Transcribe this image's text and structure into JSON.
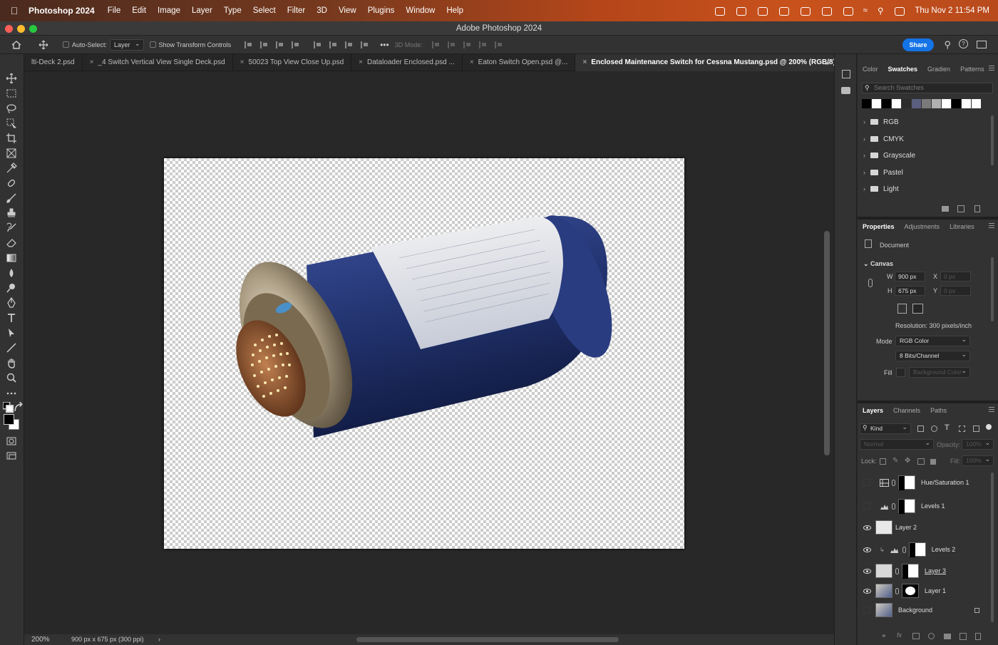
{
  "menubar": {
    "app_name": "Photoshop 2024",
    "menus": [
      "File",
      "Edit",
      "Image",
      "Layer",
      "Type",
      "Select",
      "Filter",
      "3D",
      "View",
      "Plugins",
      "Window",
      "Help"
    ],
    "clock": "Thu Nov 2  11:54 PM"
  },
  "window": {
    "title": "Adobe Photoshop 2024"
  },
  "options": {
    "auto_select_label": "Auto-Select:",
    "auto_select_value": "Layer",
    "transform_controls_label": "Show Transform Controls",
    "mode_3d_label": "3D Mode:",
    "share_label": "Share"
  },
  "tabs": [
    {
      "label": "lti-Deck 2.psd",
      "active": false
    },
    {
      "label": "_4 Switch Vertical View Single Deck.psd",
      "active": false
    },
    {
      "label": "50023 Top View Close Up.psd",
      "active": false
    },
    {
      "label": "Dataloader Enclosed.psd ...",
      "active": false
    },
    {
      "label": "Eaton Switch Open.psd @...",
      "active": false
    },
    {
      "label": "Enclosed Maintenance Switch for Cessna Mustang.psd @ 200% (RGB/8)",
      "active": true
    }
  ],
  "status": {
    "zoom": "200%",
    "doc_info": "900 px x 675 px (300 ppi)"
  },
  "swatches_panel": {
    "tabs": [
      "Color",
      "Swatches",
      "Gradien",
      "Patterns"
    ],
    "active_tab": "Swatches",
    "search_placeholder": "Search Swatches",
    "colors": [
      "#000000",
      "#ffffff",
      "#000000",
      "#ffffff",
      "#2b2b2b",
      "#5a5f80",
      "#7a7a7a",
      "#b0b0b0",
      "#ffffff",
      "#000000",
      "#ffffff",
      "#ffffff"
    ],
    "folders": [
      "RGB",
      "CMYK",
      "Grayscale",
      "Pastel",
      "Light"
    ]
  },
  "properties_panel": {
    "tabs": [
      "Properties",
      "Adjustments",
      "Libraries"
    ],
    "active_tab": "Properties",
    "doc_label": "Document",
    "canvas_label": "Canvas",
    "w_label": "W",
    "w_value": "900 px",
    "h_label": "H",
    "h_value": "675 px",
    "x_label": "X",
    "x_value": "0 px",
    "y_label": "Y",
    "y_value": "0 px",
    "resolution": "Resolution: 300 pixels/inch",
    "mode_label": "Mode",
    "mode_value": "RGB Color",
    "bits_value": "8 Bits/Channel",
    "fill_label": "Fill",
    "fill_value": "Background Color"
  },
  "layers_panel": {
    "tabs": [
      "Layers",
      "Channels",
      "Paths"
    ],
    "active_tab": "Layers",
    "kind_label": "Kind",
    "blend_mode": "Normal",
    "opacity_label": "Opacity:",
    "opacity_value": "100%",
    "lock_label": "Lock:",
    "fill_label": "Fill:",
    "fill_value": "100%",
    "layers": [
      {
        "name": "Hue/Saturation 1",
        "visible": false
      },
      {
        "name": "Levels 1",
        "visible": false
      },
      {
        "name": "Layer 2",
        "visible": true
      },
      {
        "name": "Levels 2",
        "visible": true
      },
      {
        "name": "Layer 3",
        "visible": true
      },
      {
        "name": "Layer 1",
        "visible": true
      },
      {
        "name": "Background",
        "visible": false
      }
    ]
  }
}
